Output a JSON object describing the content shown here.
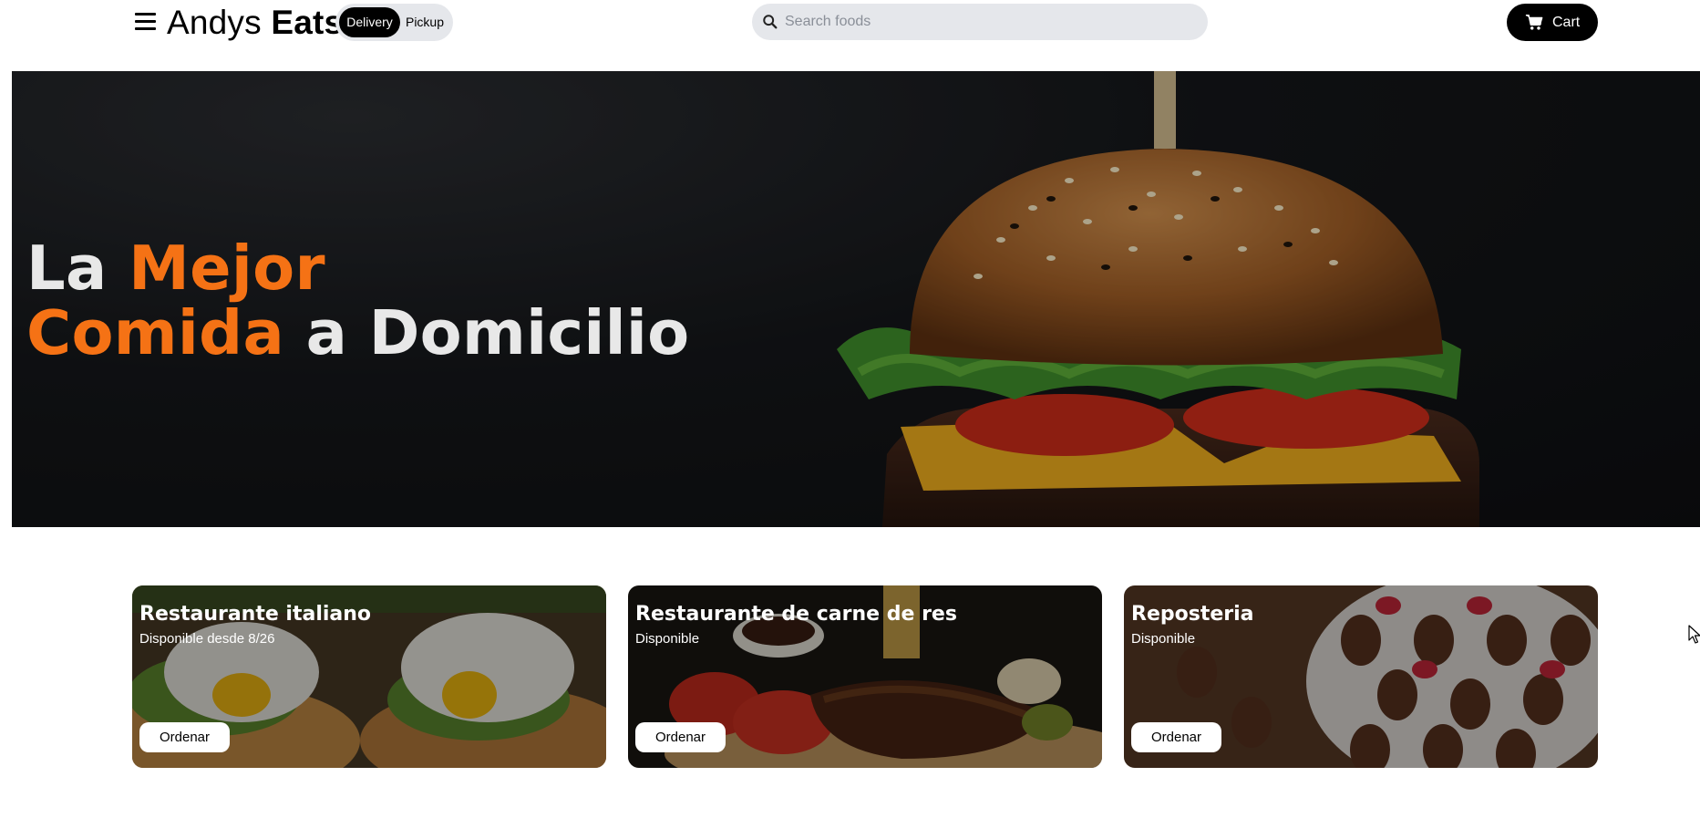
{
  "header": {
    "menu_icon": "hamburger-menu-icon",
    "brand_light": "Andys",
    "brand_bold": "Eats",
    "mode_toggle": {
      "active": "Delivery",
      "inactive": "Pickup"
    },
    "search": {
      "placeholder": "Search foods",
      "value": "",
      "icon": "search-icon"
    },
    "cart": {
      "label": "Cart",
      "icon": "shopping-cart-icon"
    }
  },
  "hero": {
    "title_line1_white": "La",
    "title_line1_accent": "Mejor",
    "title_line2_accent": "Comida",
    "title_line2_white": "a Domicilio",
    "accent_color": "#f57215",
    "image": "burger-photo"
  },
  "cards": [
    {
      "title": "Restaurante italiano",
      "status": "Disponible desde 8/26",
      "button": "Ordenar",
      "image": "eggs-avocado-toast-photo"
    },
    {
      "title": "Restaurante de carne de res",
      "status": "Disponible",
      "button": "Ordenar",
      "image": "grilled-beef-tomatoes-photo"
    },
    {
      "title": "Reposteria",
      "status": "Disponible",
      "button": "Ordenar",
      "image": "chocolate-strawberries-photo"
    }
  ]
}
